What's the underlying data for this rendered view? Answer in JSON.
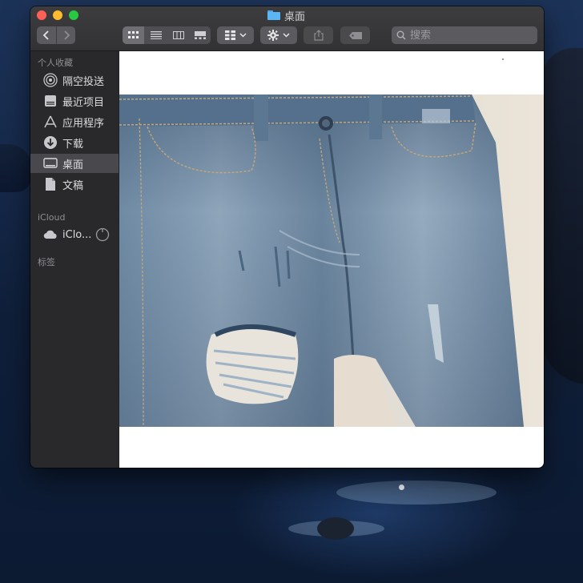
{
  "window": {
    "title": "桌面"
  },
  "toolbar": {
    "back_icon": "chevron-left-icon",
    "forward_icon": "chevron-right-icon",
    "view_modes": [
      "icon-view",
      "list-view",
      "column-view",
      "gallery-view"
    ],
    "active_view": "icon-view",
    "group_icon": "group-grid-icon",
    "action_icon": "gear-icon",
    "share_icon": "share-icon",
    "tag_icon": "tag-icon",
    "search_placeholder": "搜索"
  },
  "sidebar": {
    "favorites_header": "个人收藏",
    "favorites": [
      {
        "label": "隔空投送",
        "icon": "airdrop-icon"
      },
      {
        "label": "最近项目",
        "icon": "recents-icon"
      },
      {
        "label": "应用程序",
        "icon": "applications-icon"
      },
      {
        "label": "下载",
        "icon": "downloads-icon"
      },
      {
        "label": "桌面",
        "icon": "desktop-icon",
        "selected": true
      },
      {
        "label": "文稿",
        "icon": "document-icon"
      }
    ],
    "icloud_header": "iCloud",
    "icloud": [
      {
        "label": "iClo...",
        "icon": "icloud-icon"
      }
    ],
    "tags_header": "标签"
  },
  "content": {
    "preview": "photo of distressed light-wash blue jeans with a ripped knee"
  },
  "colors": {
    "window_bg": "#232325",
    "sidebar_bg": "#29292c",
    "selected_bg": "#49494d",
    "close": "#ff5f57",
    "minimize": "#febc2e",
    "zoom": "#28c840",
    "folder_blue": "#5ab6f5"
  }
}
